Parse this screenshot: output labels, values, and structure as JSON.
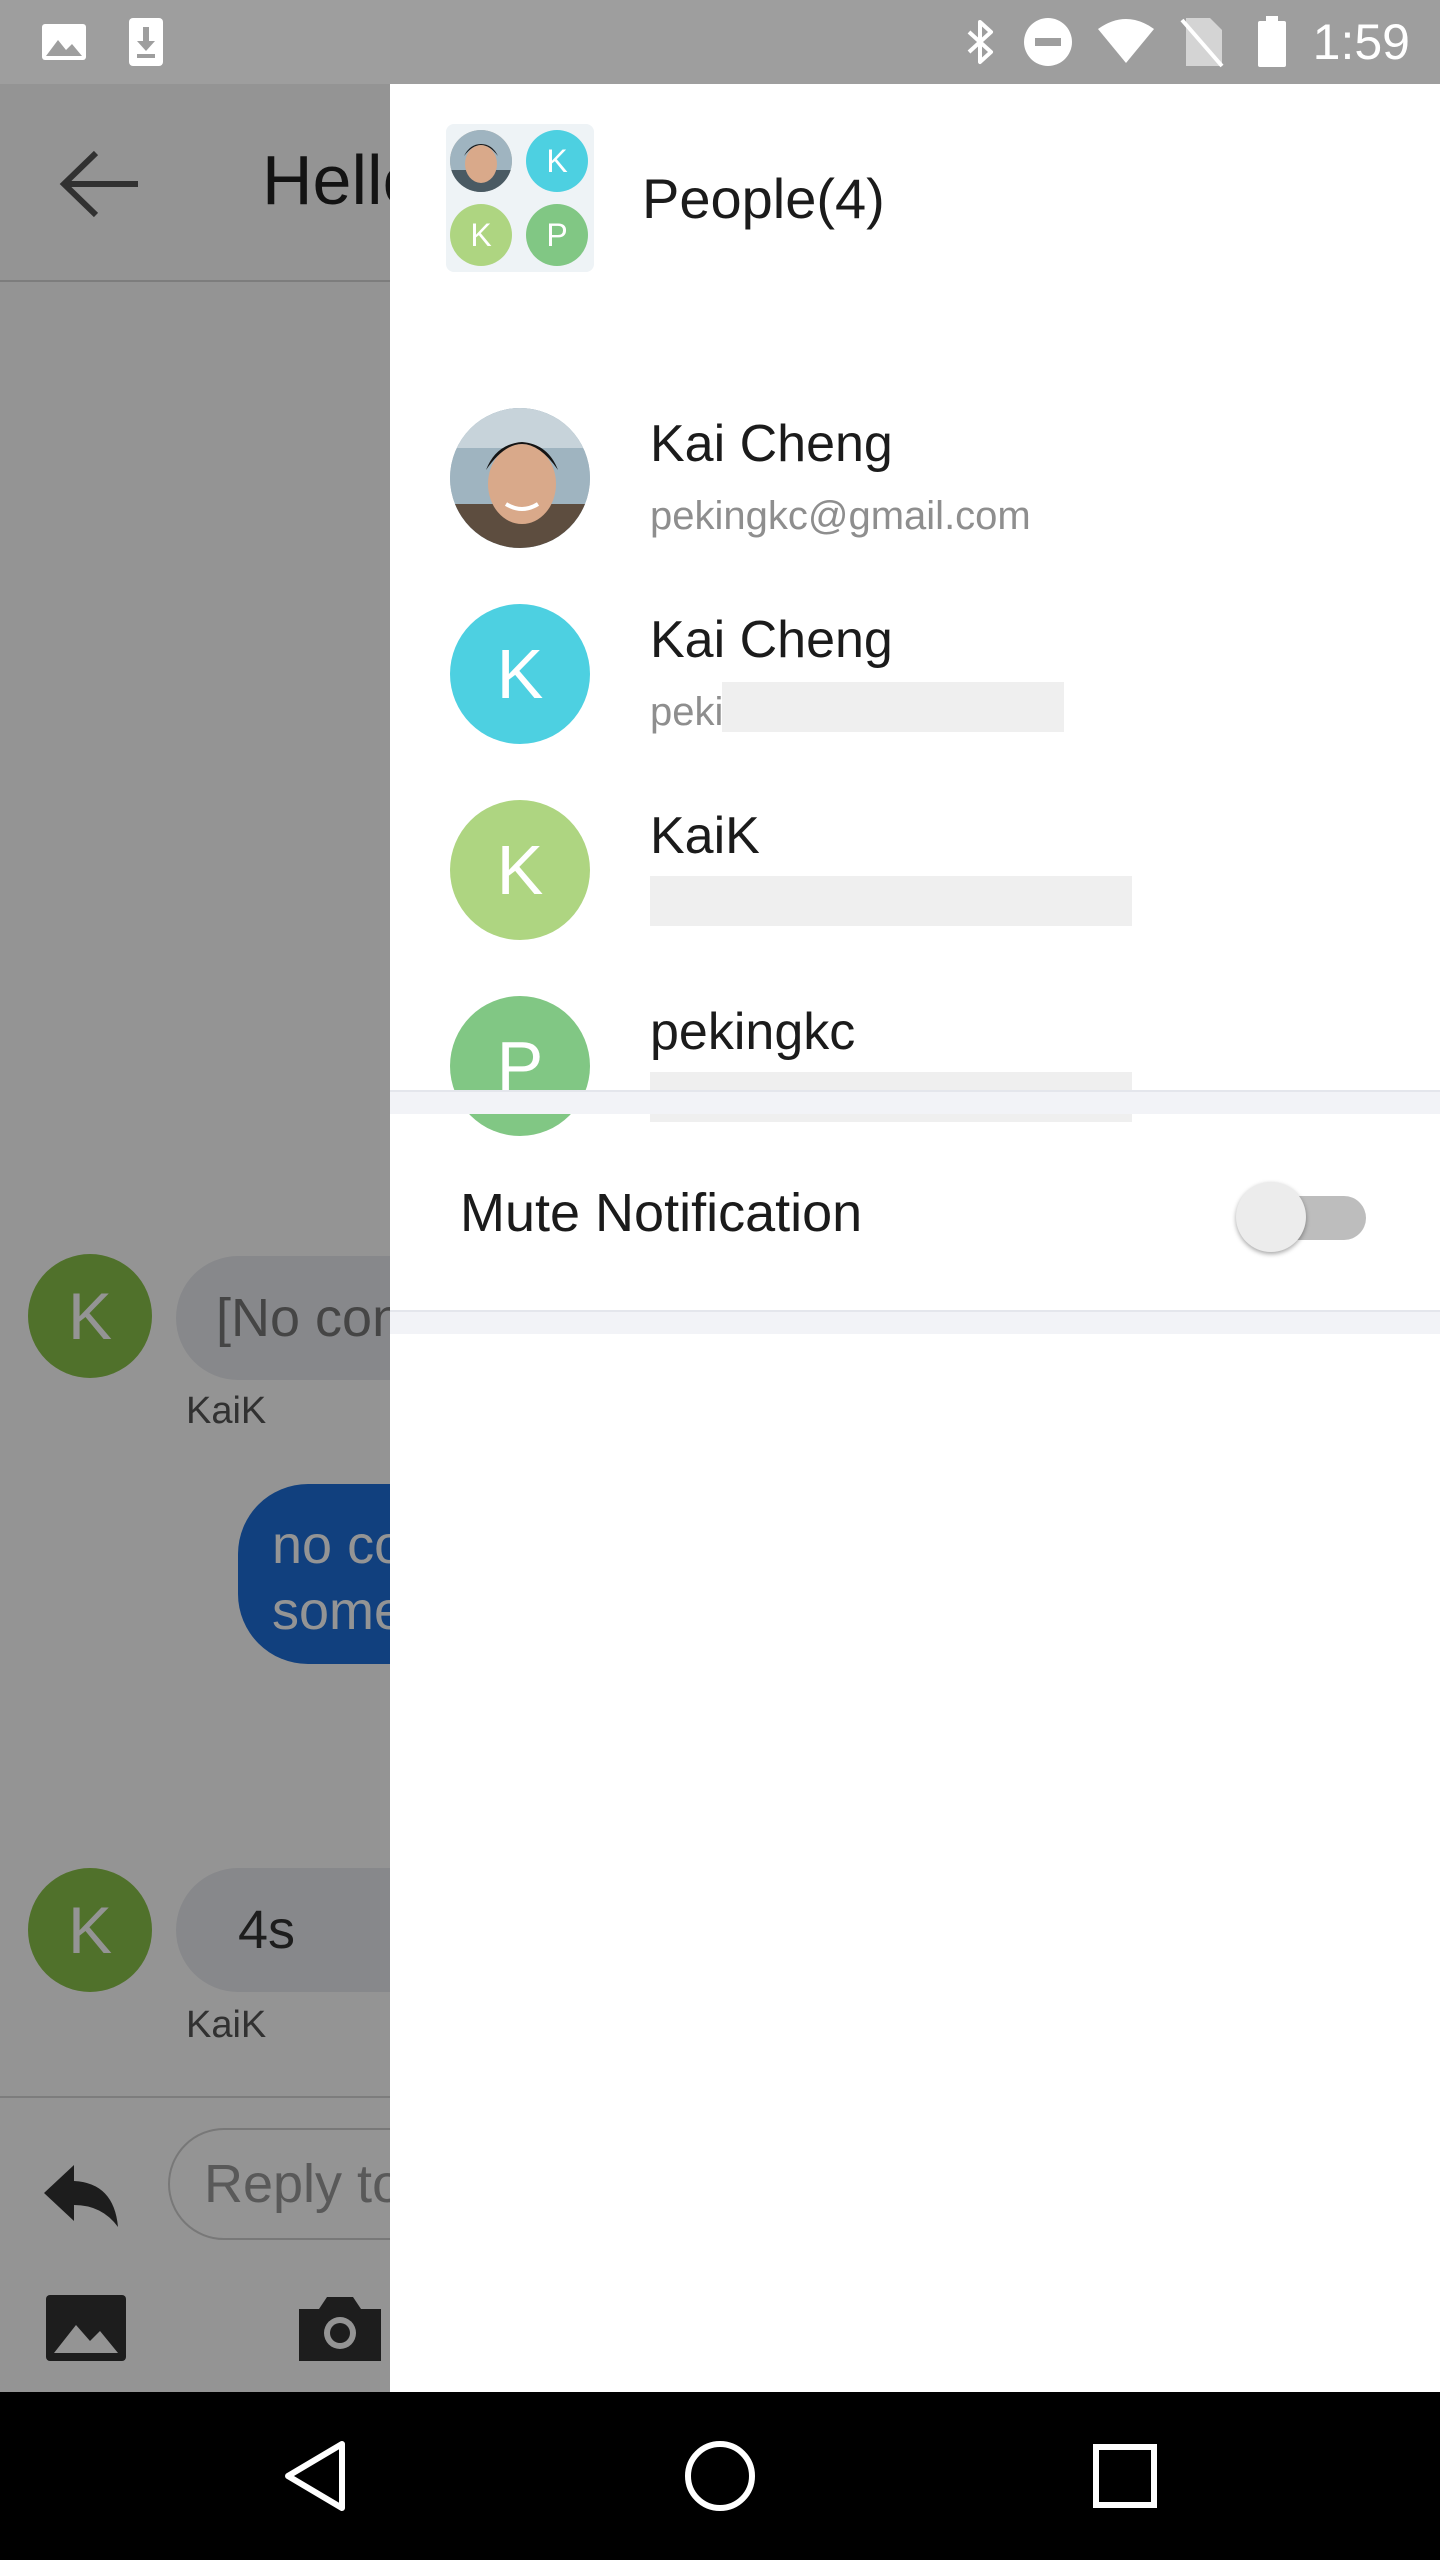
{
  "status_bar": {
    "time": "1:59",
    "left_icons": [
      "image-icon",
      "download-icon"
    ],
    "right_icons": [
      "bluetooth-icon",
      "do-not-disturb-icon",
      "wifi-icon",
      "no-sim-icon",
      "battery-icon"
    ]
  },
  "chat": {
    "title": "Hello",
    "messages": [
      {
        "avatar_letter": "K",
        "text": "[No content]",
        "sender": "KaiK"
      },
      {
        "text": "no content something"
      },
      {
        "avatar_letter": "K",
        "text": "4s",
        "sender": "KaiK"
      }
    ],
    "reply_placeholder": "Reply to",
    "toolbar_icons": [
      "image-icon",
      "camera-icon"
    ]
  },
  "drawer": {
    "people_title": "People(4)",
    "group_avatar_letters": [
      "K",
      "K",
      "P"
    ],
    "members": [
      {
        "name": "Kai Cheng",
        "email": "pekingkc@gmail.com",
        "avatar_type": "photo"
      },
      {
        "name": "Kai Cheng",
        "email": "peki",
        "avatar_letter": "K",
        "avatar_color": "#4dd0e1"
      },
      {
        "name": "KaiK",
        "email": "",
        "avatar_letter": "K",
        "avatar_color": "#aed581"
      },
      {
        "name": "pekingkc",
        "email": "",
        "avatar_letter": "P",
        "avatar_color": "#81c784"
      }
    ],
    "mute_label": "Mute Notification",
    "mute_enabled": false
  },
  "nav_bar": {
    "buttons": [
      "back-icon",
      "home-icon",
      "recents-icon"
    ]
  },
  "colors": {
    "status_bar": "#9e9e9e",
    "outgoing_bubble": "#1e6fd9",
    "avatar_k_blue": "#4dd0e1",
    "avatar_k_green": "#aed581",
    "avatar_p_green": "#81c784"
  }
}
